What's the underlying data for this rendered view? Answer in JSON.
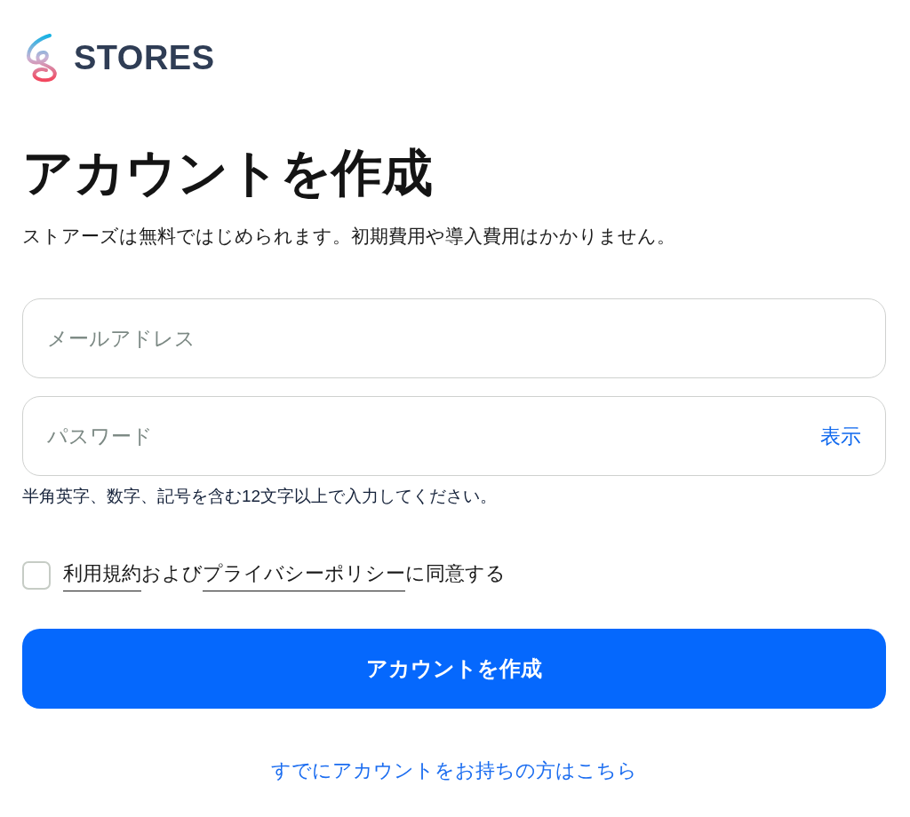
{
  "logo": {
    "text": "STORES"
  },
  "heading": "アカウントを作成",
  "subtitle": "ストアーズは無料ではじめられます。初期費用や導入費用はかかりません。",
  "form": {
    "email": {
      "placeholder": "メールアドレス"
    },
    "password": {
      "placeholder": "パスワード",
      "toggle": "表示",
      "hint": "半角英字、数字、記号を含む12文字以上で入力してください。"
    }
  },
  "agreement": {
    "checked": false,
    "parts": [
      {
        "kind": "link",
        "text": "利用規約"
      },
      {
        "kind": "text",
        "text": "および"
      },
      {
        "kind": "link",
        "text": "プライバシーポリシー"
      },
      {
        "kind": "text",
        "text": "に同意する"
      }
    ]
  },
  "submit_button": "アカウントを作成",
  "login_link": "すでにアカウントをお持ちの方はこちら"
}
